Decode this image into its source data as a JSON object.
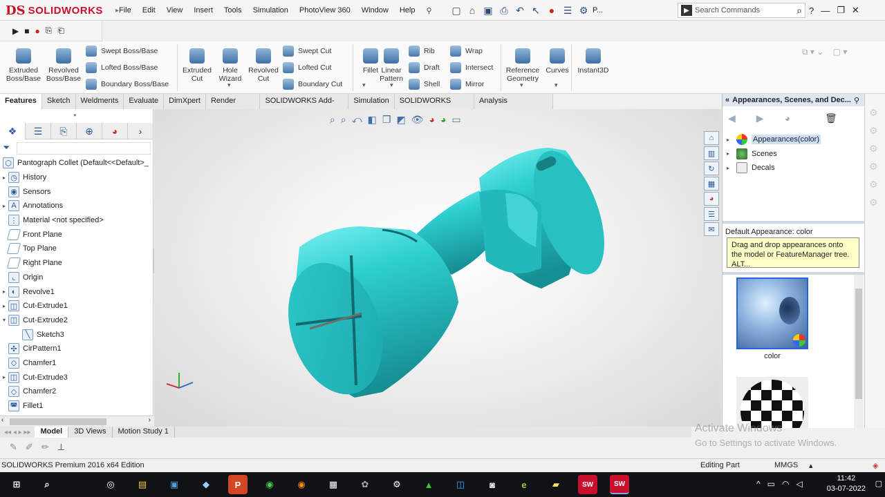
{
  "app": {
    "logo_ds": "DS",
    "logo_text": "SOLIDWORKS"
  },
  "menu": [
    "File",
    "Edit",
    "View",
    "Insert",
    "Tools",
    "Simulation",
    "PhotoView 360",
    "Window",
    "Help"
  ],
  "search": {
    "placeholder": "Search Commands"
  },
  "quick_access_tail": "P...",
  "ribbon": {
    "extruded_boss": "Extruded Boss/Base",
    "revolved_boss": "Revolved Boss/Base",
    "swept_boss": "Swept Boss/Base",
    "lofted_boss": "Lofted Boss/Base",
    "boundary_boss": "Boundary Boss/Base",
    "extruded_cut": "Extruded Cut",
    "hole_wizard": "Hole Wizard",
    "revolved_cut": "Revolved Cut",
    "swept_cut": "Swept Cut",
    "lofted_cut": "Lofted Cut",
    "boundary_cut": "Boundary Cut",
    "fillet": "Fillet",
    "linear_pattern": "Linear Pattern",
    "rib": "Rib",
    "draft": "Draft",
    "shell": "Shell",
    "wrap": "Wrap",
    "intersect": "Intersect",
    "mirror": "Mirror",
    "reference_geometry": "Reference Geometry",
    "curves": "Curves",
    "instant3d": "Instant3D"
  },
  "command_tabs": [
    "Features",
    "Sketch",
    "Weldments",
    "Evaluate",
    "DimXpert",
    "Render Tools",
    "SOLIDWORKS Add-Ins",
    "Simulation",
    "SOLIDWORKS MBD",
    "Analysis Preparation"
  ],
  "feature_tree": {
    "root": "Pantograph Collet  (Default<<Default>_",
    "items": [
      {
        "label": "History",
        "icon": "history-icon",
        "expand": "▸"
      },
      {
        "label": "Sensors",
        "icon": "sensors-icon",
        "expand": ""
      },
      {
        "label": "Annotations",
        "icon": "annotations-icon",
        "expand": "▸"
      },
      {
        "label": "Material <not specified>",
        "icon": "material-icon",
        "expand": ""
      },
      {
        "label": "Front Plane",
        "icon": "plane-icon",
        "expand": ""
      },
      {
        "label": "Top Plane",
        "icon": "plane-icon",
        "expand": ""
      },
      {
        "label": "Right Plane",
        "icon": "plane-icon",
        "expand": ""
      },
      {
        "label": "Origin",
        "icon": "origin-icon",
        "expand": ""
      },
      {
        "label": "Revolve1",
        "icon": "revolve-icon",
        "expand": "▸"
      },
      {
        "label": "Cut-Extrude1",
        "icon": "cut-extrude-icon",
        "expand": "▸"
      },
      {
        "label": "Cut-Extrude2",
        "icon": "cut-extrude-icon",
        "expand": "▾"
      },
      {
        "label": "Sketch3",
        "icon": "sketch-icon",
        "expand": "",
        "indent": true
      },
      {
        "label": "CirPattern1",
        "icon": "circular-pattern-icon",
        "expand": ""
      },
      {
        "label": "Chamfer1",
        "icon": "chamfer-icon",
        "expand": ""
      },
      {
        "label": "Cut-Extrude3",
        "icon": "cut-extrude-icon",
        "expand": "▸"
      },
      {
        "label": "Chamfer2",
        "icon": "chamfer-icon",
        "expand": ""
      },
      {
        "label": "Fillet1",
        "icon": "fillet-icon",
        "expand": ""
      }
    ]
  },
  "bottom_tabs": [
    "Model",
    "3D Views",
    "Motion Study 1"
  ],
  "task_pane": {
    "header": "Appearances, Scenes, and Dec...",
    "tree": [
      {
        "label": "Appearances(color)",
        "selected": true
      },
      {
        "label": "Scenes",
        "selected": false
      },
      {
        "label": "Decals",
        "selected": false
      }
    ],
    "default_appearance": "Default Appearance: color",
    "tooltip": "Drag and drop appearances onto the model or FeatureManager tree.  ALT...",
    "thumb1_label": "color"
  },
  "watermark": {
    "line1": "Activate Windows",
    "line2": "Go to Settings to activate Windows."
  },
  "status": {
    "left": "SOLIDWORKS Premium 2016 x64 Edition",
    "editing": "Editing Part",
    "units": "MMGS"
  },
  "taskbar": {
    "time": "11:42",
    "date": "03-07-2022"
  },
  "colors": {
    "model": "#2ec8c8",
    "accent": "#c8102e",
    "selection": "#cde0f4"
  }
}
